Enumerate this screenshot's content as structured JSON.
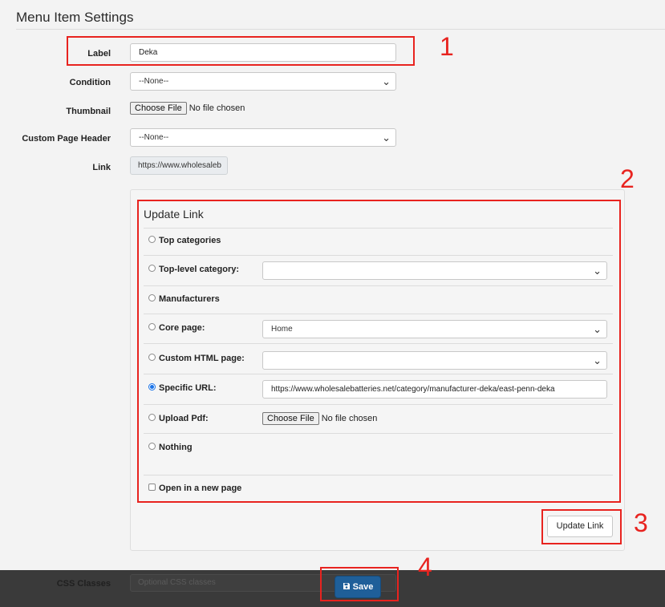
{
  "page": {
    "title": "Menu Item Settings"
  },
  "form": {
    "label_label": "Label",
    "label_value": "Deka",
    "condition_label": "Condition",
    "condition_value": "--None--",
    "thumbnail_label": "Thumbnail",
    "thumbnail_button": "Choose File",
    "thumbnail_status": "No file chosen",
    "custom_header_label": "Custom Page Header",
    "custom_header_value": "--None--",
    "link_label": "Link",
    "link_value": "https://www.wholesaleb"
  },
  "update_link": {
    "heading": "Update Link",
    "options": {
      "top_categories": "Top categories",
      "top_level_category": "Top-level category:",
      "top_level_category_value": "",
      "manufacturers": "Manufacturers",
      "core_page": "Core page:",
      "core_page_value": "Home",
      "custom_html_page": "Custom HTML page:",
      "custom_html_page_value": "",
      "specific_url": "Specific URL:",
      "specific_url_value": "https://www.wholesalebatteries.net/category/manufacturer-deka/east-penn-deka",
      "upload_pdf": "Upload Pdf:",
      "upload_pdf_button": "Choose File",
      "upload_pdf_status": "No file chosen",
      "nothing": "Nothing"
    },
    "selected_option": "specific_url",
    "open_new_page": "Open in a new page",
    "open_new_page_checked": false,
    "update_button": "Update Link"
  },
  "footer": {
    "css_classes_label": "CSS Classes",
    "css_classes_placeholder": "Optional CSS classes",
    "save_label": "Save"
  },
  "annotations": [
    "1",
    "2",
    "3",
    "4"
  ],
  "colors": {
    "annotation": "#e8231f",
    "save_button": "#1f5f99",
    "radio_selected": "#1a73e8",
    "footer_bar": "#3a3a3a"
  }
}
